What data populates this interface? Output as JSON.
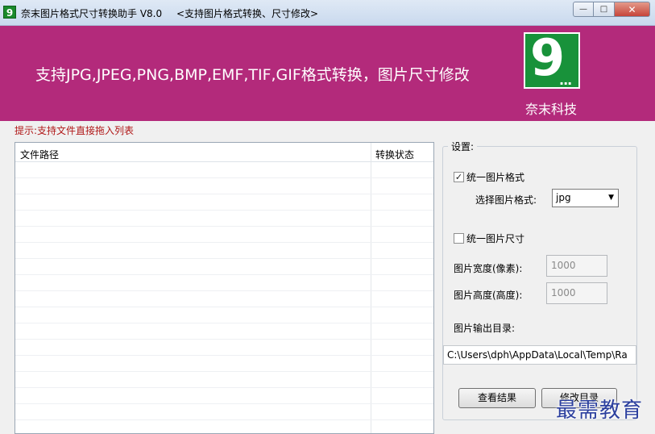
{
  "window": {
    "icon_glyph": "9",
    "title": "奈末图片格式尺寸转换助手 V8.0",
    "subtitle": "<支持图片格式转换、尺寸修改>",
    "controls": {
      "minimize": "—",
      "maximize": "□",
      "close": "✕"
    }
  },
  "banner": {
    "headline": "支持JPG,JPEG,PNG,BMP,EMF,TIF,GIF格式转换，图片尺寸修改",
    "logo_digit": "9",
    "logo_dots": "...",
    "company": "奈末科技",
    "background_color": "#b32a7b",
    "logo_color": "#18923a"
  },
  "hint": "提示:支持文件直接拖入列表",
  "file_list": {
    "columns": [
      "文件路径",
      "转换状态"
    ],
    "rows": []
  },
  "settings": {
    "group_title": "设置:",
    "unify_format": {
      "label": "统一图片格式",
      "checked": true
    },
    "format_label": "选择图片格式:",
    "format_value": "jpg",
    "unify_size": {
      "label": "统一图片尺寸",
      "checked": false
    },
    "width_label": "图片宽度(像素):",
    "width_value": "1000",
    "height_label": "图片高度(高度):",
    "height_value": "1000",
    "output_label": "图片输出目录:",
    "output_path": "C:\\Users\\dph\\AppData\\Local\\Temp\\Ra",
    "view_button": "查看结果",
    "change_dir_button": "修改目录"
  },
  "watermark": "最需教育"
}
